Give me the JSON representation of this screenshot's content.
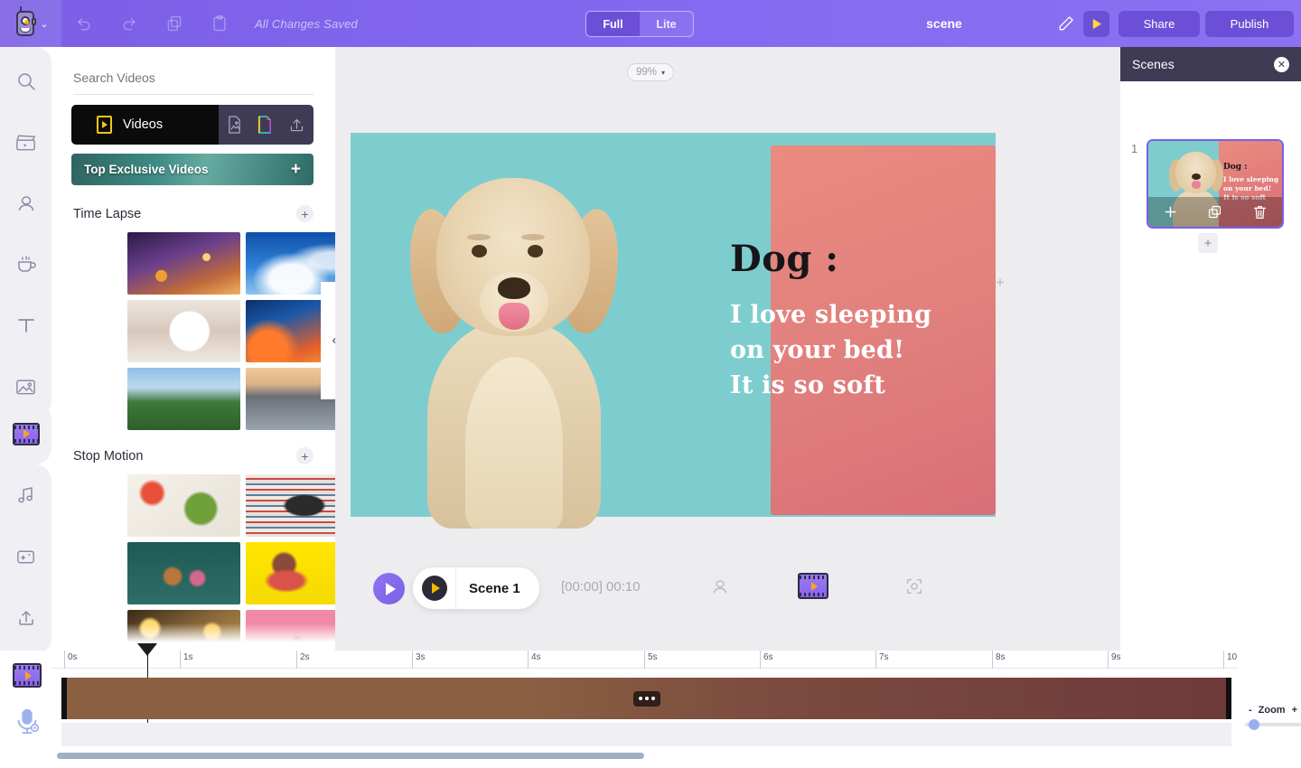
{
  "topbar": {
    "brand_icon": "robot-logo",
    "brand_caret": "⌄",
    "undo_icon": "undo-icon",
    "redo_icon": "redo-icon",
    "copy_icon": "copy-icon",
    "clipboard_icon": "clipboard-icon",
    "save_status": "All Changes Saved",
    "mode_full": "Full",
    "mode_lite": "Lite",
    "project_title": "scene",
    "edit_icon": "pencil-icon",
    "preview_icon": "play-icon",
    "share_label": "Share",
    "publish_label": "Publish"
  },
  "rail": {
    "items": [
      {
        "name": "search-icon"
      },
      {
        "name": "clapperboard-icon"
      },
      {
        "name": "person-icon"
      },
      {
        "name": "coffee-icon"
      },
      {
        "name": "text-icon"
      },
      {
        "name": "image-icon"
      },
      {
        "name": "video-icon"
      },
      {
        "name": "music-icon"
      },
      {
        "name": "effects-icon"
      },
      {
        "name": "upload-icon"
      }
    ],
    "bottom": [
      {
        "name": "filmstrip-icon"
      },
      {
        "name": "microphone-icon"
      }
    ]
  },
  "panel": {
    "search_placeholder": "Search Videos",
    "search_value": "",
    "tab_videos_label": "Videos",
    "tab_icons": [
      "image-tab-icon",
      "graphic-tab-icon",
      "upload-tab-icon"
    ],
    "banner_label": "Top Exclusive Videos",
    "banner_plus": "+",
    "sections": [
      {
        "title": "Time Lapse",
        "add": "+",
        "thumbs": [
          {
            "label": "night-highway",
            "cls": "t-highway"
          },
          {
            "label": "blue-sky-clouds",
            "cls": "t-sky"
          },
          {
            "label": "mall-clock",
            "cls": "t-clock"
          },
          {
            "label": "bridge-sunset",
            "cls": "t-bridge"
          },
          {
            "label": "green-mountain",
            "cls": "t-mount"
          },
          {
            "label": "city-river",
            "cls": "t-river"
          }
        ]
      },
      {
        "title": "Stop Motion",
        "add": "+",
        "thumbs": [
          {
            "label": "healthy-food",
            "cls": "t-food"
          },
          {
            "label": "sneakers-rug",
            "cls": "t-shoes"
          },
          {
            "label": "clay-figures",
            "cls": "t-clay"
          },
          {
            "label": "woman-yellow",
            "cls": "t-yellow"
          },
          {
            "label": "gift-lights",
            "cls": "t-gift"
          },
          {
            "label": "tomatoes-pink",
            "cls": "t-tomato"
          }
        ]
      }
    ],
    "collapse_icon": "‹"
  },
  "stage": {
    "zoom_value": "99%",
    "zoom_caret": "▾",
    "canvas": {
      "teal_color": "#7ecdce",
      "coral_color": "#e07f7d",
      "title": "Dog :",
      "body_line1": "I love sleeping",
      "body_line2": "on your bed!",
      "body_line3": "It is so soft",
      "photo": "dog-labrador-photo"
    },
    "plus_marker": "+"
  },
  "playback": {
    "play_icon": "play-icon",
    "scene_label": "Scene 1",
    "scene_play_icon": "play-icon",
    "timecode": "[00:00] 00:10",
    "person_icon": "person-icon",
    "filmstrip_icon": "filmstrip-icon",
    "focus_icon": "focus-frame-icon"
  },
  "scenes": {
    "title": "Scenes",
    "close_icon": "✕",
    "items": [
      {
        "number": "1",
        "thumb_title": "Dog :",
        "thumb_line1": "I love sleeping",
        "thumb_line2": "on your bed!",
        "thumb_line3": "It is so soft",
        "actions": [
          "add-icon",
          "duplicate-icon",
          "delete-icon"
        ]
      }
    ],
    "add_scene": "+"
  },
  "timeline": {
    "left_icons": [
      "filmstrip-icon",
      "microphone-icon"
    ],
    "ticks": [
      "0s",
      "1s",
      "2s",
      "3s",
      "4s",
      "5s",
      "6s",
      "7s",
      "8s",
      "9s",
      "10"
    ],
    "clip_menu": "•••",
    "zoom_label": "Zoom",
    "zoom_minus": "-",
    "zoom_plus": "+"
  },
  "colors": {
    "brand_purple": "#7b5fe6",
    "dark_panel": "#3f3b54",
    "accent_yellow": "#f5c518",
    "teal": "#7ecdce",
    "coral": "#e07f7d"
  }
}
